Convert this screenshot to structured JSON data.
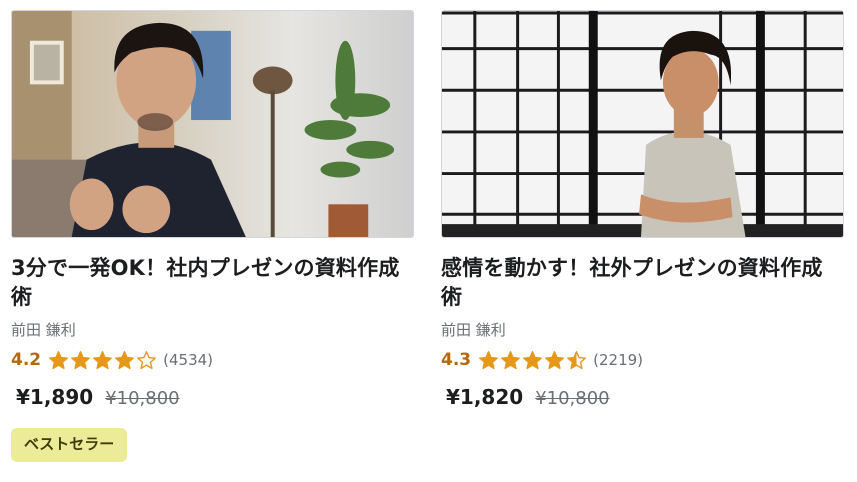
{
  "courses": [
    {
      "title": "3分で一発OK！社内プレゼンの資料作成術",
      "instructor": "前田 鎌利",
      "rating": "4.2",
      "rating_value": 4.2,
      "rating_count": "(4534)",
      "price": "¥1,890",
      "original_price": "¥10,800",
      "badge": "ベストセラー",
      "thumbnail_icon": "instructor-photo-office"
    },
    {
      "title": "感情を動かす！社外プレゼンの資料作成術",
      "instructor": "前田 鎌利",
      "rating": "4.3",
      "rating_value": 4.3,
      "rating_count": "(2219)",
      "price": "¥1,820",
      "original_price": "¥10,800",
      "thumbnail_icon": "instructor-photo-shoji"
    }
  ],
  "colors": {
    "rating": "#b4690e",
    "star": "#e59819",
    "badge_bg": "#eceb98",
    "muted_text": "#6a6f73"
  }
}
